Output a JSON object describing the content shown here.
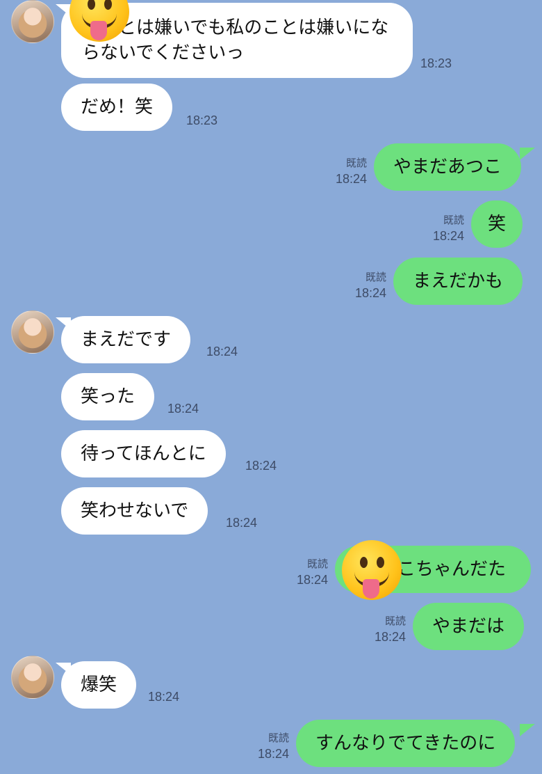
{
  "messages": [
    {
      "side": "in",
      "text": "俺のことは嫌いでも私のことは嫌いにならないでくださいっ",
      "visible_text": "のことは嫌いでも私のことは嫌いにならないでくださいっ",
      "time": "18:23"
    },
    {
      "side": "in",
      "text": "だめ！笑",
      "time": "18:23"
    },
    {
      "side": "out",
      "text": "やまだあつこ",
      "read": "既読",
      "time": "18:24"
    },
    {
      "side": "out",
      "text": "笑",
      "read": "既読",
      "time": "18:24"
    },
    {
      "side": "out",
      "text": "まえだかも",
      "read": "既読",
      "time": "18:24"
    },
    {
      "side": "in",
      "text": "まえだです",
      "time": "18:24"
    },
    {
      "side": "in",
      "text": "笑った",
      "time": "18:24"
    },
    {
      "side": "in",
      "text": "待ってほんとに",
      "time": "18:24"
    },
    {
      "side": "in",
      "text": "笑わせないで",
      "time": "18:24"
    },
    {
      "side": "out",
      "text": "こちゃんだた",
      "read": "既読",
      "time": "18:24"
    },
    {
      "side": "out",
      "text": "やまだは",
      "read": "既読",
      "time": "18:24"
    },
    {
      "side": "in",
      "text": "爆笑",
      "time": "18:24"
    },
    {
      "side": "out",
      "text": "すんなりでてきたのに",
      "read": "既読",
      "time": "18:24"
    }
  ],
  "overlay_icons": [
    "tongue-out-emoji",
    "tongue-out-emoji"
  ]
}
